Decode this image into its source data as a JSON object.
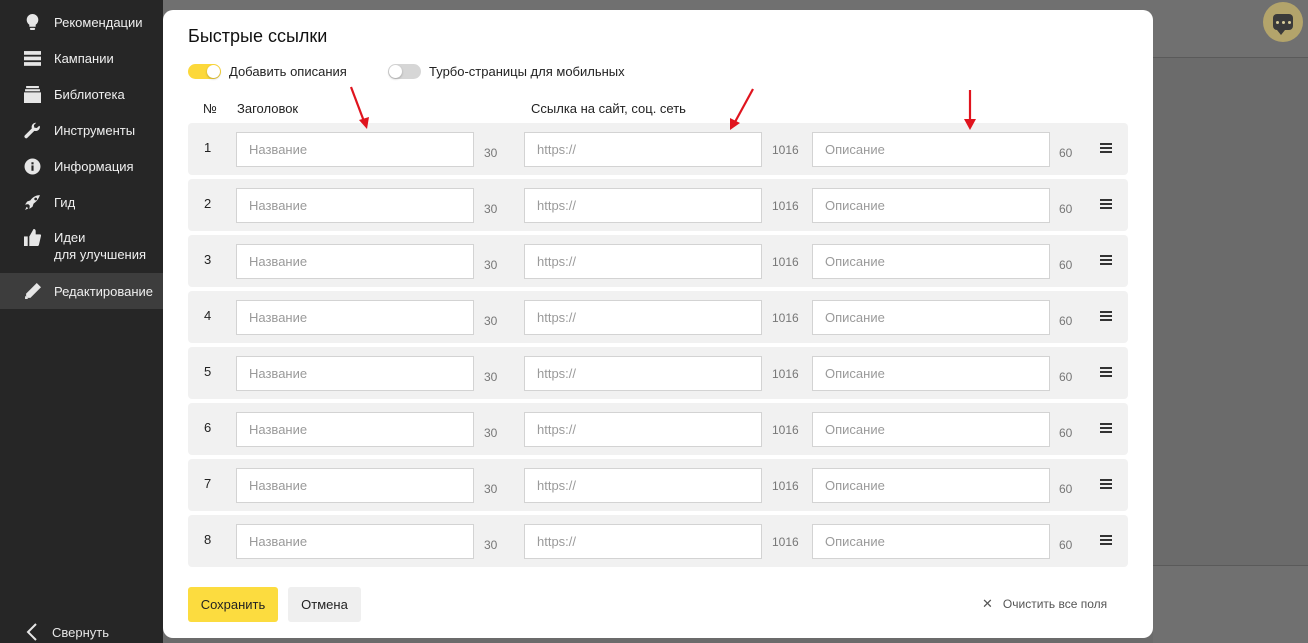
{
  "sidebar": {
    "items": [
      {
        "label": "Рекомендации",
        "icon": "lightbulb-icon"
      },
      {
        "label": "Кампании",
        "icon": "list-icon"
      },
      {
        "label": "Библиотека",
        "icon": "library-icon"
      },
      {
        "label": "Инструменты",
        "icon": "wrench-icon"
      },
      {
        "label": "Информация",
        "icon": "info-icon"
      },
      {
        "label": "Гид",
        "icon": "rocket-icon"
      },
      {
        "label": "Идеи\nдля улучшения",
        "icon": "thumbs-up-icon"
      },
      {
        "label": "Редактирование",
        "icon": "pencil-icon",
        "active": true
      }
    ],
    "collapse_label": "Свернуть"
  },
  "modal": {
    "title": "Быстрые ссылки",
    "toggle_descriptions": {
      "label": "Добавить описания",
      "on": true
    },
    "toggle_turbo": {
      "label": "Турбо-страницы для мобильных",
      "on": false
    },
    "columns": {
      "num": "№",
      "title": "Заголовок",
      "link": "Ссылка на сайт, соц. сеть"
    },
    "placeholders": {
      "title": "Название",
      "link": "https://",
      "description": "Описание"
    },
    "limits": {
      "title": "30",
      "link": "1016",
      "description": "60"
    },
    "rows": [
      {
        "num": "1"
      },
      {
        "num": "2"
      },
      {
        "num": "3"
      },
      {
        "num": "4"
      },
      {
        "num": "5"
      },
      {
        "num": "6"
      },
      {
        "num": "7"
      },
      {
        "num": "8"
      }
    ],
    "save_label": "Сохранить",
    "cancel_label": "Отмена",
    "clear_label": "Очистить все поля"
  },
  "colors": {
    "accent": "#fcdc3f",
    "sidebar": "#262626",
    "annotation_arrow": "#e0141e"
  }
}
